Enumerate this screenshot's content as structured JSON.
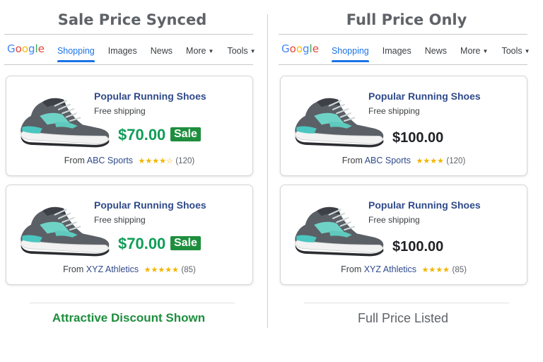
{
  "colors": {
    "sale_green": "#1e8e3e",
    "title_blue": "#2f4a8a",
    "tab_blue": "#1a73e8",
    "star": "#f4b400"
  },
  "nav": {
    "logo": [
      "G",
      "o",
      "o",
      "g",
      "l",
      "e"
    ],
    "logo_colors": [
      "#4285f4",
      "#ea4335",
      "#fbbc05",
      "#4285f4",
      "#34a853",
      "#ea4335"
    ],
    "tabs": [
      "Shopping",
      "Images",
      "News",
      "More",
      "Tools"
    ]
  },
  "left": {
    "title": "Sale Price Synced",
    "caption": "Attractive Discount Shown",
    "cards": [
      {
        "title": "Popular Running Shoes",
        "shipping": "Free shipping",
        "price": "$70.00",
        "badge": "Sale",
        "from": "From",
        "store": "ABC Sports",
        "rating": 4,
        "stars": "★★★★☆",
        "reviews": "(120)"
      },
      {
        "title": "Popular Running Shoes",
        "shipping": "Free shipping",
        "price": "$70.00",
        "badge": "Sale",
        "from": "From",
        "store": "XYZ Athletics",
        "rating": 4.5,
        "stars": "★★★★★",
        "reviews": "(85)"
      }
    ]
  },
  "right": {
    "title": "Full Price Only",
    "caption": "Full Price Listed",
    "cards": [
      {
        "title": "Popular Running Shoes",
        "shipping": "Free shipping",
        "price": "$100.00",
        "from": "From",
        "store": "ABC Sports",
        "rating": 4.5,
        "stars": "★★★★",
        "reviews": "(120)"
      },
      {
        "title": "Popular Running Shoes",
        "shipping": "Free shipping",
        "price": "$100.00",
        "from": "From",
        "store": "XYZ Athletics",
        "rating": 4.5,
        "stars": "★★★★",
        "reviews": "(85)"
      }
    ]
  }
}
